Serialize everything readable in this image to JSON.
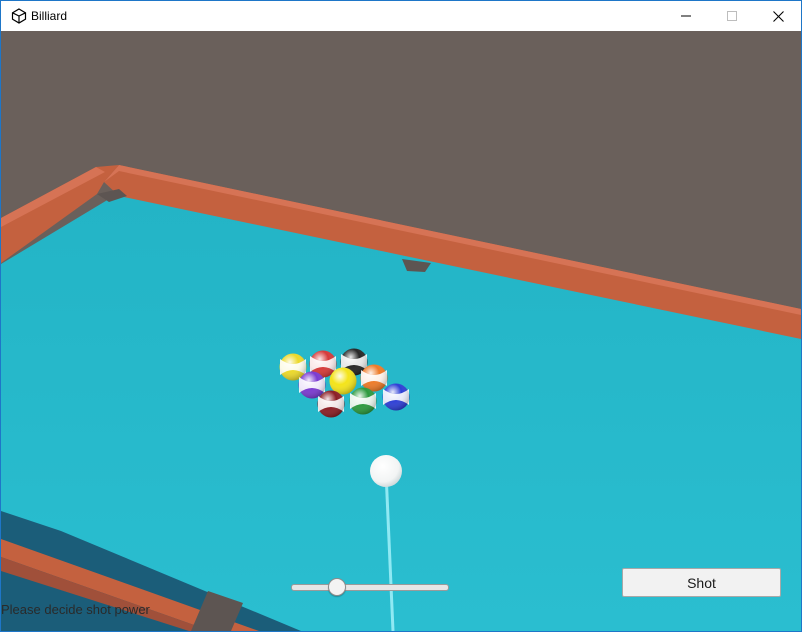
{
  "window": {
    "title": "Billiard",
    "controls": [
      "minimize-icon",
      "maximize-icon",
      "close-icon"
    ]
  },
  "scene": {
    "wall_color": "#6a605b",
    "felt_color": "#28b7ca",
    "rail_color": "#c8664a",
    "cue_line_color": "#8fe9f3",
    "object_balls": [
      {
        "name": "yellow-ball",
        "color": "#ecd92a",
        "stripe": true
      },
      {
        "name": "red-ball",
        "color": "#d63a3a",
        "stripe": true
      },
      {
        "name": "black-ball",
        "color": "#262626",
        "stripe": true
      },
      {
        "name": "purple-ball",
        "color": "#7b3ad1",
        "stripe": true
      },
      {
        "name": "solid-yellow-ball",
        "color": "#f4e41a",
        "stripe": false
      },
      {
        "name": "orange-ball",
        "color": "#ee7b28",
        "stripe": true
      },
      {
        "name": "maroon-ball",
        "color": "#8c1e24",
        "stripe": true
      },
      {
        "name": "green-ball",
        "color": "#2d9a3e",
        "stripe": true
      },
      {
        "name": "blue-ball",
        "color": "#2e3fd6",
        "stripe": true
      }
    ],
    "cue_ball": {
      "name": "cue-ball",
      "color": "#ffffff"
    }
  },
  "controls": {
    "power_slider_value": 0.29,
    "shot_label": "Shot"
  },
  "status": {
    "message": "Please decide shot power"
  }
}
